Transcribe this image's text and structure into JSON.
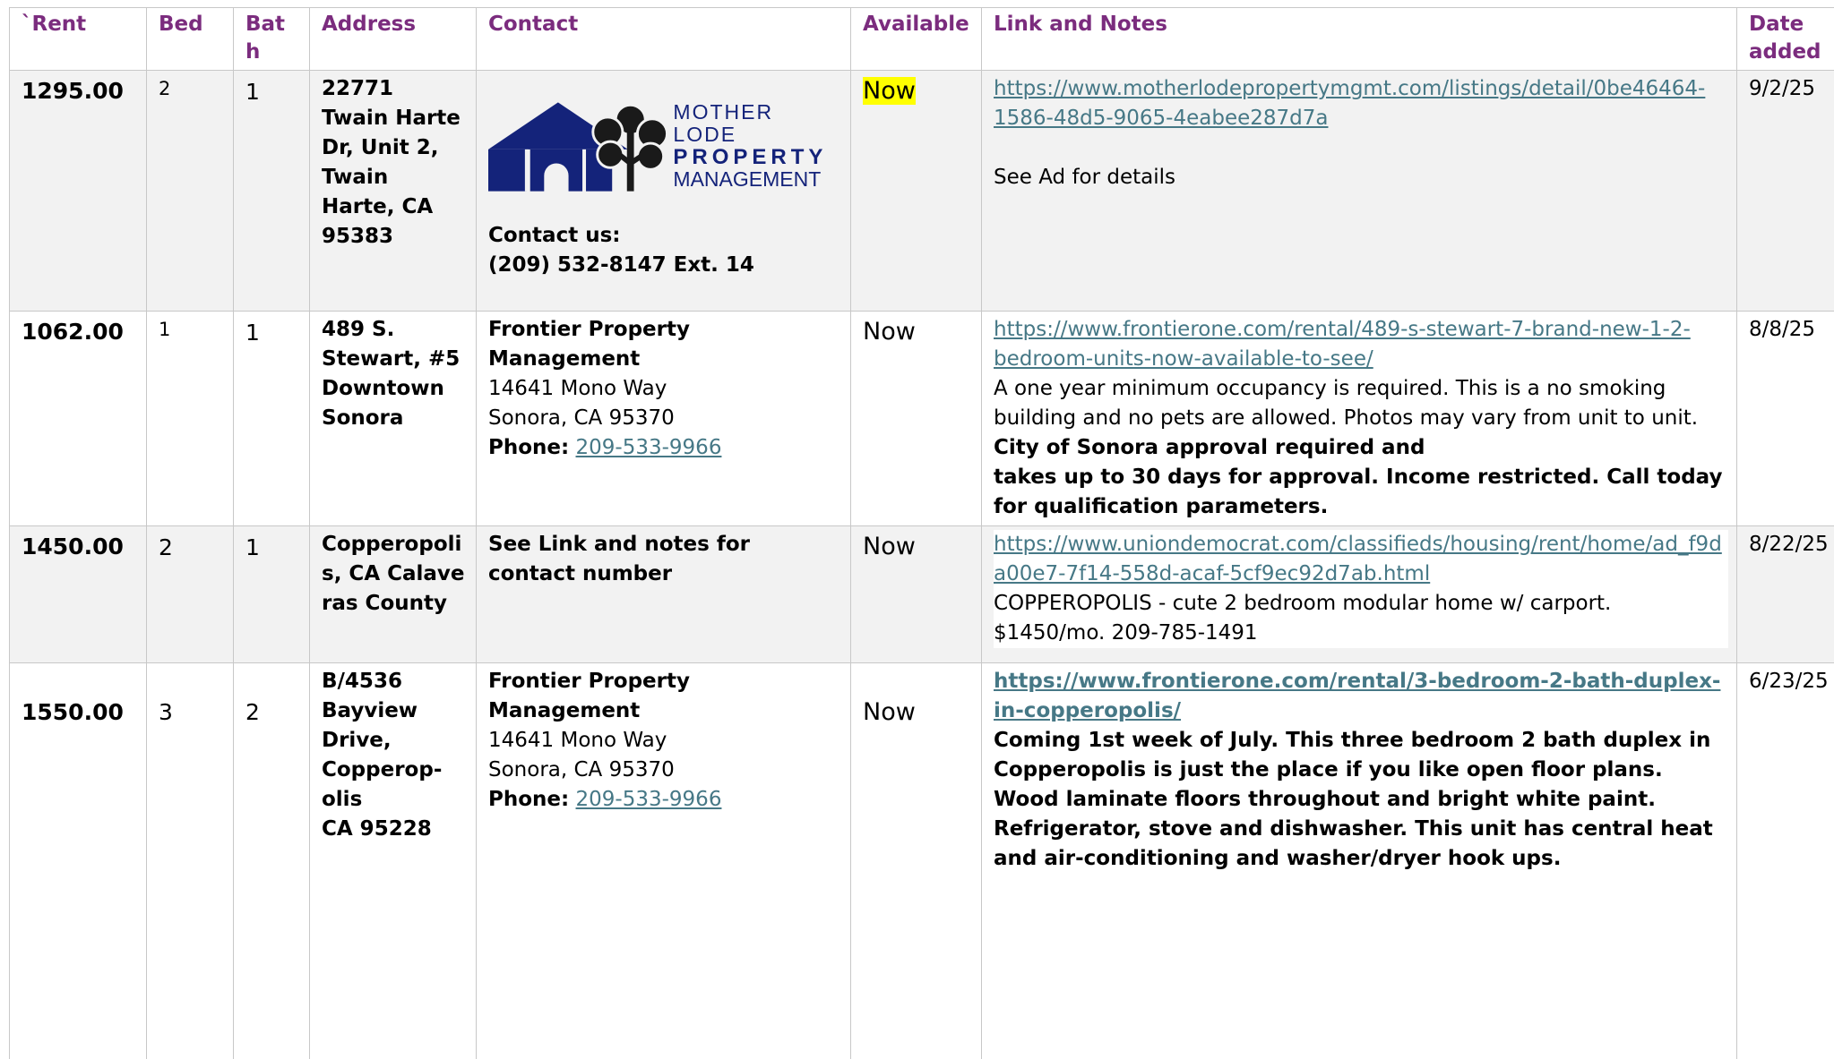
{
  "headers": {
    "rent": "`Rent",
    "bed": "Bed",
    "bath": "Bath",
    "address": "Address",
    "contact": "Contact",
    "available": "Available",
    "link_notes": "Link and Notes",
    "date_added": "Date added"
  },
  "colors": {
    "header_text": "#7b2c7e",
    "link": "#467886",
    "highlight": "#ffff00",
    "logo_blue": "#14237a"
  },
  "listings": [
    {
      "rent": "1295.00",
      "bed": "2",
      "bath": "1",
      "address": "22771 Twain Harte Dr, Unit 2, Twain Harte, CA 95383",
      "contact": {
        "logo": {
          "line1": "MOTHER LODE",
          "line2": "PROPERTY",
          "line3": "MANAGEMENT",
          "icon": "house-tree-logo-icon"
        },
        "label": "Contact us:",
        "phone": "(209) 532-8147 Ext. 14"
      },
      "available": "Now",
      "link": "https://www.motherlodepropertymgmt.com/listings/detail/0be46464-1586-48d5-9065-4eabee287d7a",
      "notes": "See Ad for details",
      "date_added": "9/2/25"
    },
    {
      "rent": "1062.00",
      "bed": "1",
      "bath": "1",
      "address": "489 S. Stewart, #5 Downtown Sonora",
      "contact": {
        "company": "Frontier Property Management",
        "street": "14641 Mono Way",
        "city": "Sonora, CA 95370",
        "phone_label": "Phone:",
        "phone": "209-533-9966"
      },
      "available": "Now",
      "link": "https://www.frontierone.com/rental/489-s-stewart-7-brand-new-1-2-bedroom-units-now-available-to-see/",
      "notes": "A one year minimum occupancy is required.  This is a no smoking building and no pets are allowed. Photos may vary from unit to unit.",
      "notes_bold_1": "City of Sonora approval required and",
      "notes_bold_2": "takes up to 30 days for approval. Income restricted. Call today for qualification parameters.",
      "date_added": "8/8/25"
    },
    {
      "rent": "1450.00",
      "bed": "2",
      "bath": "1",
      "address": "Copperopolis,  CA Calaveras County",
      "contact": {
        "text": "See Link and notes for contact number"
      },
      "available": "Now",
      "link": "https://www.uniondemocrat.com/classifieds/housing/rent/home/ad_f9da00e7-7f14-558d-acaf-5cf9ec92d7ab.html",
      "notes": "COPPEROPOLIS - cute 2 bedroom modular home w/ carport. $1450/mo. 209-785-1491",
      "date_added": "8/22/25"
    },
    {
      "rent": "1550.00",
      "bed": "3",
      "bath": "2",
      "address_line1": "B/4536 Bayview Drive, Copperop-olis",
      "address_line2": "CA 95228",
      "contact": {
        "company": "Frontier Property Management",
        "street": "14641 Mono Way",
        "city": "Sonora, CA 95370",
        "phone_label": "Phone:",
        "phone": "209-533-9966"
      },
      "available": "Now",
      "link": "https://www.frontierone.com/rental/3-bedroom-2-bath-duplex-in-copperopolis/",
      "notes": "Coming 1st week of July.  This three bedroom 2 bath duplex in Copperopolis is just the place if you like open floor plans. Wood laminate floors throughout and bright white paint.  Refrigerator, stove and dishwasher. This unit has central heat and air-conditioning and washer/dryer hook ups.",
      "date_added": "6/23/25"
    }
  ]
}
